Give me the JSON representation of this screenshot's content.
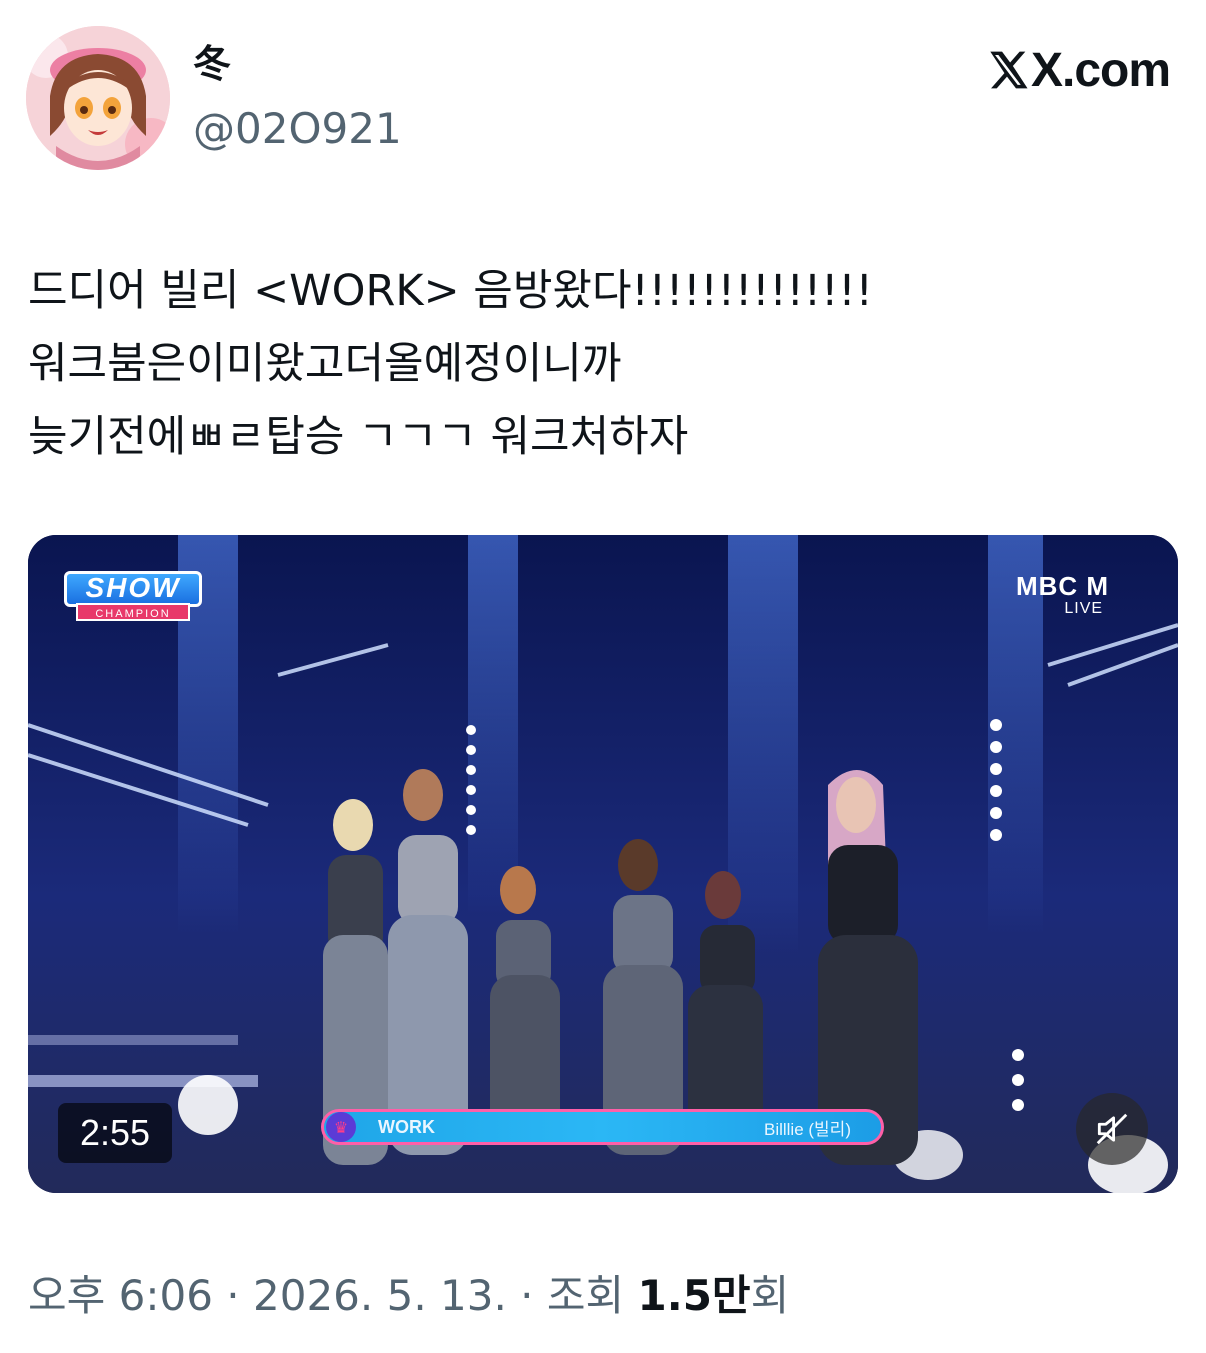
{
  "author": {
    "display_name": "冬",
    "handle": "@02O921",
    "avatar": "anime-girl-avatar"
  },
  "brand": {
    "label": "X.com",
    "icon": "x-logo-icon"
  },
  "tweet": {
    "lines": [
      "드디어 빌리 <WORK> 음방왔다!!!!!!!!!!!!!!",
      "워크붐은이미왔고더올예정이니까",
      "늦기전에ㅃㄹ탑승 ㄱㄱㄱ 워크처하자"
    ]
  },
  "video": {
    "duration": "2:55",
    "show_logo": {
      "main": "SHOW",
      "sub": "CHAMPION"
    },
    "channel_logo": {
      "main": "MBC M",
      "sub": "LIVE"
    },
    "lower_third": {
      "song": "WORK",
      "artist": "Billlie (빌리)"
    },
    "mute_icon": "speaker-muted-icon",
    "colors": {
      "accent": "#2bb7f5",
      "border": "#ff5fa8"
    }
  },
  "meta": {
    "time": "오후 6:06",
    "sep1": " · ",
    "date": "2026. 5. 13.",
    "sep2": " · ",
    "views_label": "조회 ",
    "views_count": "1.5만",
    "views_suffix": "회"
  }
}
